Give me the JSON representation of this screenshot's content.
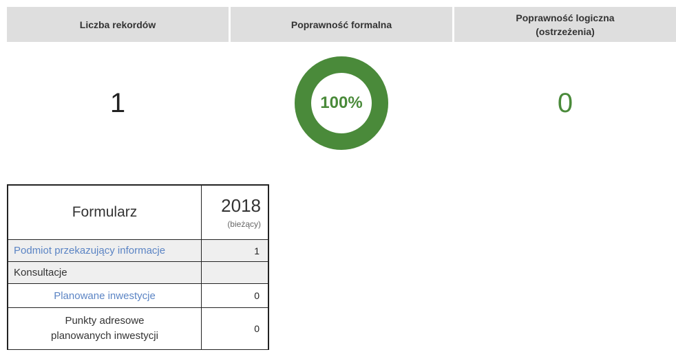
{
  "summary": {
    "headers": {
      "records": "Liczba rekordów",
      "formal": "Poprawność formalna",
      "logical_line1": "Poprawność logiczna",
      "logical_line2": "(ostrzeżenia)"
    },
    "values": {
      "records": "1",
      "formal_percent_label": "100%",
      "formal_percent": 100,
      "logical_warnings": "0"
    },
    "colors": {
      "header_bg": "#dedede",
      "success_green": "#4a8a3a",
      "link_blue": "#5b84c4"
    }
  },
  "table": {
    "header": {
      "form_label": "Formularz",
      "year": "2018",
      "year_note": "(bieżący)"
    },
    "rows": [
      {
        "label": "Podmiot przekazujący informacje",
        "value": "1"
      },
      {
        "label": "Konsultacje",
        "value": ""
      },
      {
        "label": "Planowane inwestycje",
        "value": "0"
      },
      {
        "label": "Punkty adresowe planowanych inwestycji",
        "value": "0"
      }
    ]
  }
}
